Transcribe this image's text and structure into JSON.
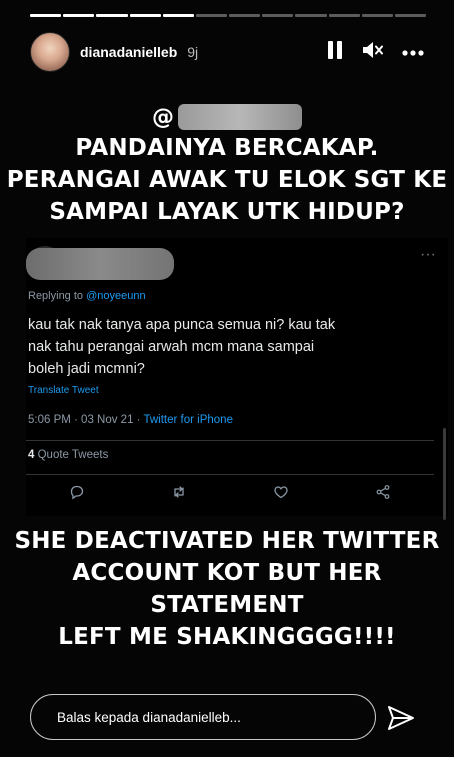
{
  "story": {
    "progress_segments": 12,
    "progress_completed": 5,
    "username": "dianadanielleb",
    "time": "9j"
  },
  "icons": {
    "pause": "pause-icon",
    "mute": "speaker-muted-icon",
    "more": "more-horizontal-icon",
    "send": "send-icon"
  },
  "top_caption": {
    "handle_prefix": "@",
    "lines": [
      "PANDAINYA BERCAKAP.",
      "PERANGAI AWAK TU ELOK SGT KE",
      "SAMPAI LAYAK UTK HIDUP?"
    ]
  },
  "tweet": {
    "more": "···",
    "replying_prefix": "Replying to ",
    "replying_to": "@noyeeunn",
    "body_lines": [
      "kau tak nak tanya apa punca semua ni? kau tak",
      "nak tahu perangai arwah mcm mana sampai",
      "boleh jadi mcmni?"
    ],
    "translate": "Translate Tweet",
    "timestamp": "5:06 PM · 03 Nov 21 · ",
    "source": "Twitter for iPhone",
    "quote_count": "4",
    "quote_label": " Quote Tweets"
  },
  "bottom_caption": {
    "lines": [
      "SHE DEACTIVATED HER TWITTER",
      "ACCOUNT KOT BUT HER STATEMENT",
      "LEFT ME SHAKINGGGG!!!!"
    ]
  },
  "reply": {
    "placeholder": "Balas kepada dianadanielleb..."
  },
  "colors": {
    "background": "#050505",
    "twitter_blue": "#1d9bf0",
    "muted_text": "#8b98a5"
  }
}
